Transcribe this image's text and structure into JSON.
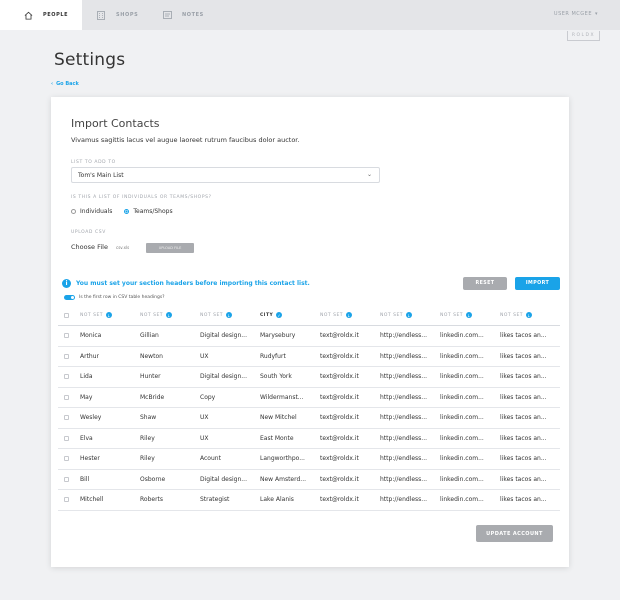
{
  "nav": {
    "tabs": [
      {
        "label": "People",
        "icon": "home-icon"
      },
      {
        "label": "Shops",
        "icon": "building-icon"
      },
      {
        "label": "Notes",
        "icon": "notes-icon"
      }
    ],
    "user": "USER MCGEE",
    "brand": "ROLDX"
  },
  "page_title": "Settings",
  "go_back": "Go Back",
  "card": {
    "title": "Import Contacts",
    "description": "Vivamus sagittis lacus vel augue laoreet rutrum faucibus dolor auctor.",
    "list_label": "LIST TO ADD TO",
    "list_value": "Tom's Main List",
    "type_label": "IS THIS A LIST OF INDIVIDUALS OR TEAMS/SHOPS?",
    "radio_options": [
      "Individuals",
      "Teams/Shops"
    ],
    "radio_selected": "Teams/Shops",
    "upload_label": "UPLOAD CSV",
    "choose_file": "Choose File",
    "csv_name": "csv.xls",
    "upload_button": "UPLOAD FILE",
    "notice": "You must set your section headers before importing this contact list.",
    "reset": "RESET",
    "import": "IMPORT",
    "toggle_label": "Is the first row in CSV table headings?",
    "update_button": "UPDATE ACCOUNT"
  },
  "table": {
    "headers": [
      "NOT SET",
      "NOT SET",
      "NOT SET",
      "CITY",
      "NOT SET",
      "NOT SET",
      "NOT SET",
      "NOT SET"
    ],
    "rows": [
      [
        "Monica",
        "Gillian",
        "Digital design...",
        "Marysebury",
        "text@roldx.it",
        "http://endless...",
        "linkedin.com...",
        "likes tacos an..."
      ],
      [
        "Arthur",
        "Newton",
        "UX",
        "Rudyfurt",
        "text@roldx.it",
        "http://endless...",
        "linkedin.com...",
        "likes tacos an..."
      ],
      [
        "Lida",
        "Hunter",
        "Digital design...",
        "South York",
        "text@roldx.it",
        "http://endless...",
        "linkedin.com...",
        "likes tacos an..."
      ],
      [
        "May",
        "McBride",
        "Copy",
        "Wildermanst...",
        "text@roldx.it",
        "http://endless...",
        "linkedin.com...",
        "likes tacos an..."
      ],
      [
        "Wesley",
        "Shaw",
        "UX",
        "New Mitchel",
        "text@roldx.it",
        "http://endless...",
        "linkedin.com...",
        "likes tacos an..."
      ],
      [
        "Elva",
        "Riley",
        "UX",
        "East Monte",
        "text@roldx.it",
        "http://endless...",
        "linkedin.com...",
        "likes tacos an..."
      ],
      [
        "Hester",
        "Riley",
        "Acount",
        "Langworthpo...",
        "text@roldx.it",
        "http://endless...",
        "linkedin.com...",
        "likes tacos an..."
      ],
      [
        "Bill",
        "Osborne",
        "Digital design...",
        "New Amsterd...",
        "text@roldx.it",
        "http://endless...",
        "linkedin.com...",
        "likes tacos an..."
      ],
      [
        "Mitchell",
        "Roberts",
        "Strategist",
        "Lake Alanis",
        "text@roldx.it",
        "http://endless...",
        "linkedin.com...",
        "likes tacos an..."
      ]
    ]
  },
  "colors": {
    "accent": "#1aa3e8",
    "gray_button": "#a9abaf",
    "nav_bg": "#e4e5e8"
  }
}
